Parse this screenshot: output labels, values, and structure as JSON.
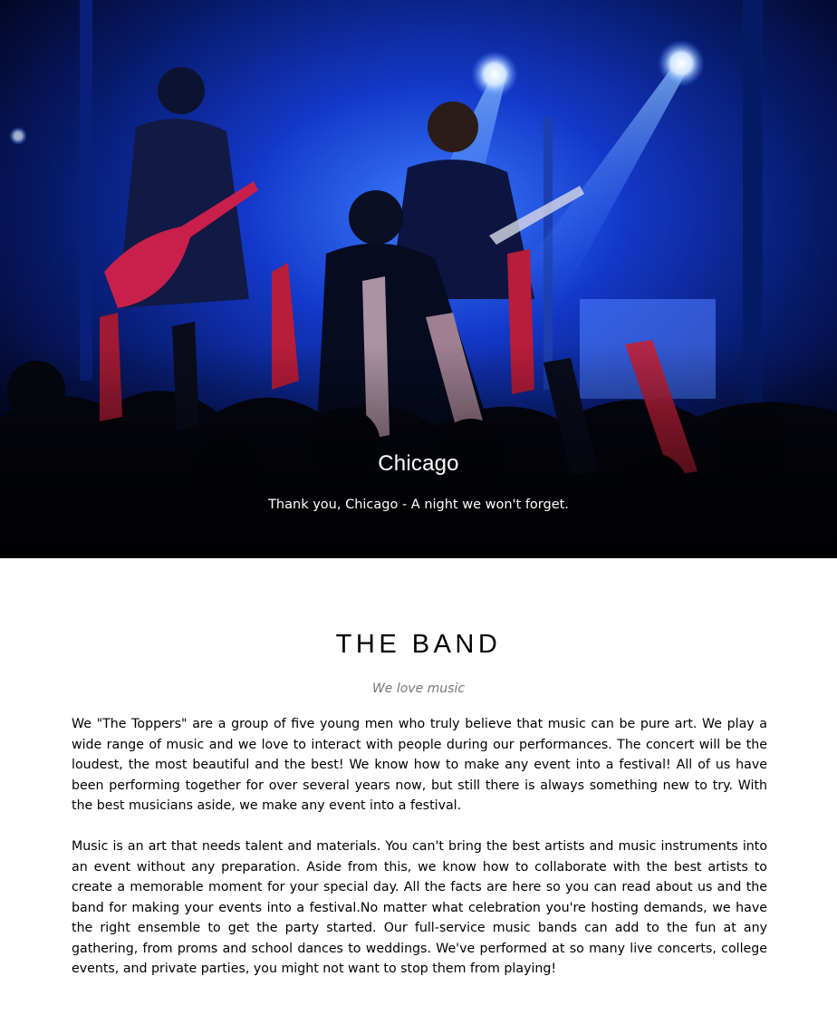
{
  "hero": {
    "title": "Chicago",
    "text": "Thank you, Chicago - A night we won't forget."
  },
  "band": {
    "title": "THE BAND",
    "subtitle": "We love music",
    "paragraphs": [
      "We \"The Toppers\" are a group of five young men who truly believe that music can be pure art. We play a wide range of music and we love to interact with people during our performances. The concert will be the loudest, the most beautiful and the best! We know how to make any event into a festival! All of us have been performing together for over several years now, but still there is always something new to try. With the best musicians aside, we make any event into a festival.",
      "Music is an art that needs talent and materials. You can't bring the best artists and music instruments into an event without any preparation. Aside from this, we know how to collaborate with the best artists to create a memorable moment for your special day. All the facts are here so you can read about us and the band for making your events into a festival.No matter what celebration you're hosting demands, we have the right ensemble to get the party started. Our full-service music bands can add to the fun at any gathering, from proms and school dances to weddings. We've performed at so many live concerts, college events, and private parties, you might not want to stop them from playing!"
    ]
  },
  "colors": {
    "stage_blue": "#1a4dff",
    "light_glow": "#bfe0ff",
    "crowd_dark": "#05060f",
    "crowd_red": "#c0203a",
    "subtitle_gray": "#777777"
  }
}
